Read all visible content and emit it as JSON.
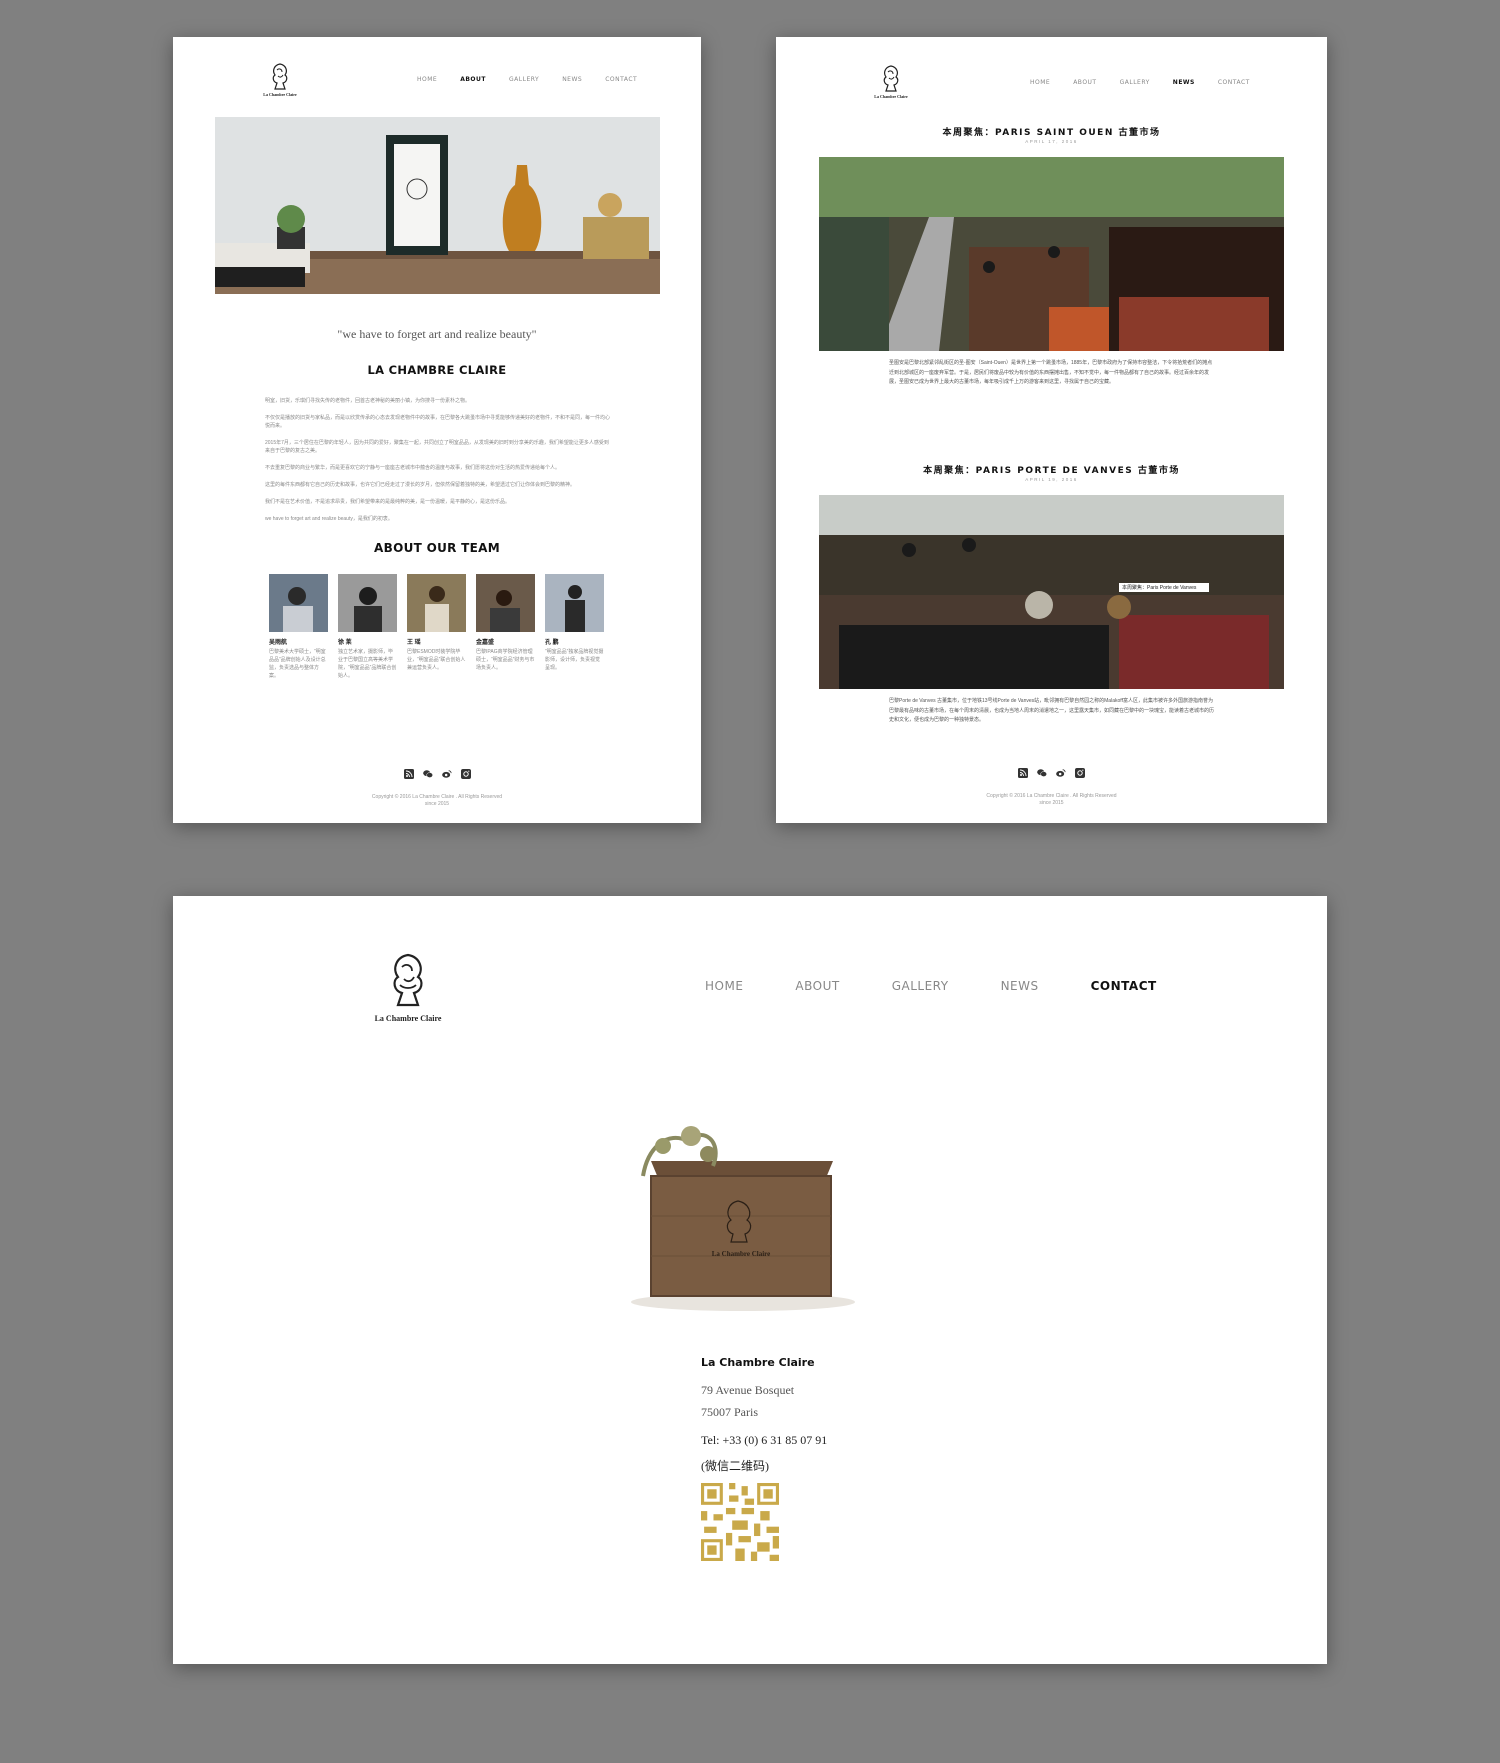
{
  "brand": {
    "name": "La Chambre Claire"
  },
  "nav": {
    "items": [
      "HOME",
      "ABOUT",
      "GALLERY",
      "NEWS",
      "CONTACT"
    ]
  },
  "colors": {
    "background": "#808080",
    "page": "#ffffff",
    "qr": "#c9a94a"
  },
  "about_page": {
    "active_nav": "ABOUT",
    "quote": "\"we have to forget art and realize beauty\"",
    "title": "LA CHAMBRE CLAIRE",
    "paragraphs": [
      "明室，旧货，乐琪们寻找失传的老物件，回首古老神秘的美丽小镇，为你搜寻一份素朴之物。",
      "不仅仅是播放的旧货与家私品，而是以欣赏传承的心态去发现老物件中的故事，在巴黎各大跳蚤市场中寻觅能够传递美好的老物件，不和不是同，每一件均心悦而来。",
      "2015年7月，三个居住在巴黎的年轻人，因为共同的爱好，聚集在一起，共同创立了明室品品，从发现美的旧时到分享美的乐趣，我们希望能让更多人感受到来自于巴黎的复古之美。",
      "不去重复巴黎的商业与繁华，而是更喜欢它的宁静与一座座古老城市中蕴含的温度与故事，我们愿将这份对生活的热爱传递给每个人。",
      "这里的每件东西都有它自己的历史和故事，也许它们已经走过了漫长的岁月，但依然保留着独特的美，希望透过它们让你体会到巴黎的精神。",
      "我们不是在艺术价值，不是追求昂贵，我们希望带来的是最纯粹的美，是一份温暖，是平静的心，是这份乐品。"
    ],
    "paragraph_tail": "we have to forget art and realize beauty，是我们的初衷。",
    "team_title": "ABOUT OUR TEAM",
    "team": [
      {
        "name": "吴雨航",
        "bio": "巴黎美术大学硕士，“明室品品”品牌创始人及设计总监，负责选品与整体方案。"
      },
      {
        "name": "徐 莱",
        "bio": "独立艺术家，摄影师，毕业于巴黎国立高等美术学院，“明室品品”品牌联合创始人。"
      },
      {
        "name": "王 瑶",
        "bio": "巴黎ESMOD时装学院毕业，“明室品品”联合创始人兼运营负责人。"
      },
      {
        "name": "金嘉盛",
        "bio": "巴黎IPAG商学院经济管理硕士，“明室品品”财务与市场负责人。"
      },
      {
        "name": "孔 鹏",
        "bio": "“明室品品”独家品牌视觉摄影师，设计师，负责视觉呈现。"
      }
    ],
    "copyright": "Copyright © 2016 La Chambre Claire . All Rights Reserved",
    "since": "since 2015"
  },
  "news_page": {
    "active_nav": "NEWS",
    "articles": [
      {
        "title": "本周聚焦：PARIS SAINT OUEN 古董市场",
        "date": "APRIL 17, 2016",
        "body": "圣图安是巴黎北部紧邻乱街区的圣-图安（Saint-Ouen）是世界上第一个跳蚤市场，1885年，巴黎市政府为了保持市容整洁，下令将拾荒者们的摊点迁到北部城区的一座废弃军营。于是，居民们将废品中较为有价值的东西摆摊出售，不知不觉中，每一件物品都有了自己的故事。经过百余年的发展，圣图安已成为世界上最大的古董市场，每年吸引成千上万的游客来到这里，寻找属于自己的宝藏。"
      },
      {
        "title": "本周聚焦：PARIS PORTE DE VANVES 古董市场",
        "date": "APRIL 19, 2016",
        "body": "巴黎Porte de Vanves 古董集市，位于地铁13号线Porte de Vanves站，毗邻拥有巴黎自然园之称的Malakoff富人区，此集市被许多外国旅游指南誉为巴黎最有品味的古董市场，在每个周末的清晨，也成为当地人周末的消遣地之一，这里露天集市，如同藏在巴黎中的一块瑰宝，能读着古老城市的历史和文化，便也成为巴黎的一种独特景态。"
      }
    ],
    "image_caption": "本周聚焦：Paris Porte de Vanves",
    "copyright": "Copyright © 2016 La Chambre Claire . All Rights Reserved",
    "since": "since 2015"
  },
  "contact_page": {
    "active_nav": "CONTACT",
    "business_name": "La Chambre Claire",
    "address_line1": "79 Avenue Bosquet",
    "address_line2": "75007 Paris",
    "tel": "Tel: +33 (0) 6 31 85 07 91",
    "wechat_label": "(微信二维码)"
  },
  "icons": [
    "rss-icon",
    "wechat-icon",
    "weibo-icon",
    "instagram-icon"
  ]
}
